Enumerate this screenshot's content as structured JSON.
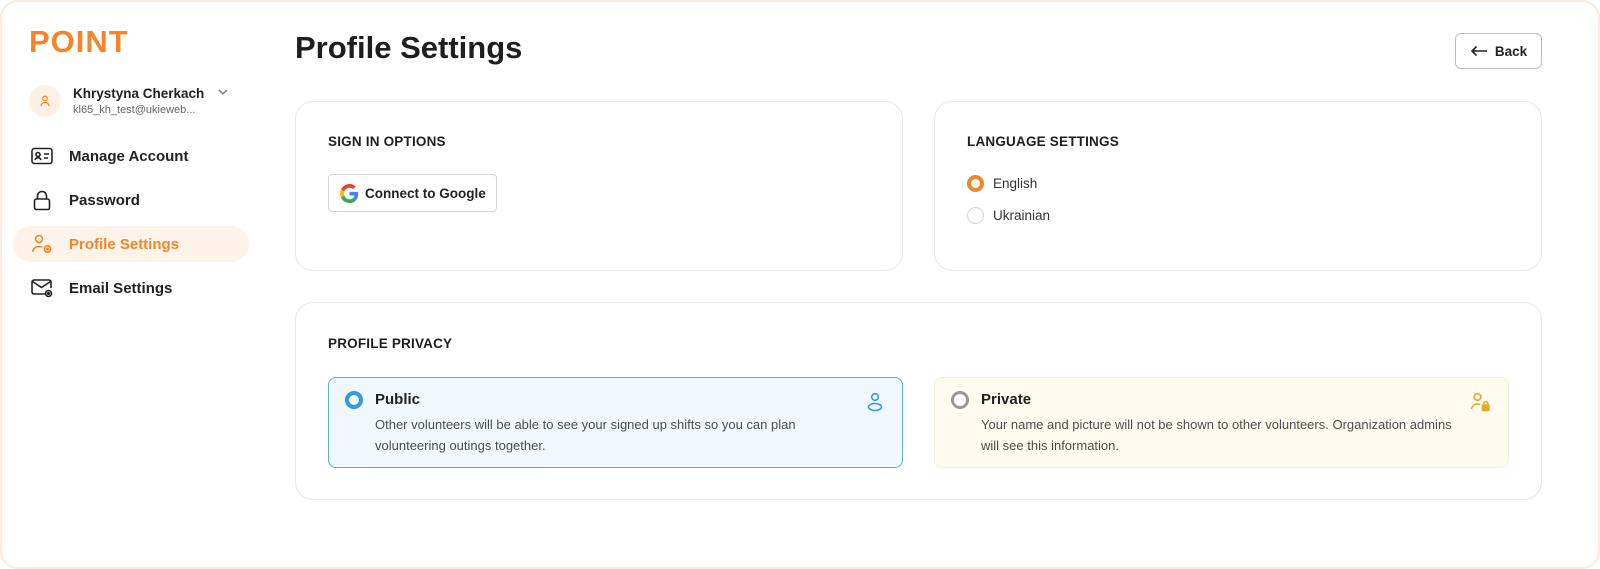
{
  "brand": {
    "logo": "POINT",
    "accent": "#f4862a"
  },
  "user": {
    "name": "Khrystyna Cherkach",
    "email": "kl65_kh_test@ukieweb..."
  },
  "sidebar": {
    "items": [
      {
        "label": "Manage Account",
        "icon": "id-card-icon",
        "active": false
      },
      {
        "label": "Password",
        "icon": "lock-icon",
        "active": false
      },
      {
        "label": "Profile Settings",
        "icon": "user-settings-icon",
        "active": true
      },
      {
        "label": "Email Settings",
        "icon": "mail-settings-icon",
        "active": false
      }
    ]
  },
  "header": {
    "title": "Profile Settings",
    "back_label": "Back"
  },
  "sign_in": {
    "title": "SIGN IN OPTIONS",
    "google_button": "Connect to Google"
  },
  "language": {
    "title": "LANGUAGE SETTINGS",
    "options": [
      {
        "label": "English",
        "selected": true
      },
      {
        "label": "Ukrainian",
        "selected": false
      }
    ]
  },
  "privacy": {
    "title": "PROFILE PRIVACY",
    "public": {
      "title": "Public",
      "description": "Other volunteers will be able to see your signed up shifts so you can plan volunteering outings together.",
      "selected": true
    },
    "private": {
      "title": "Private",
      "description": "Your name and picture will not be shown to other volunteers. Organization admins will see this information.",
      "selected": false
    }
  }
}
